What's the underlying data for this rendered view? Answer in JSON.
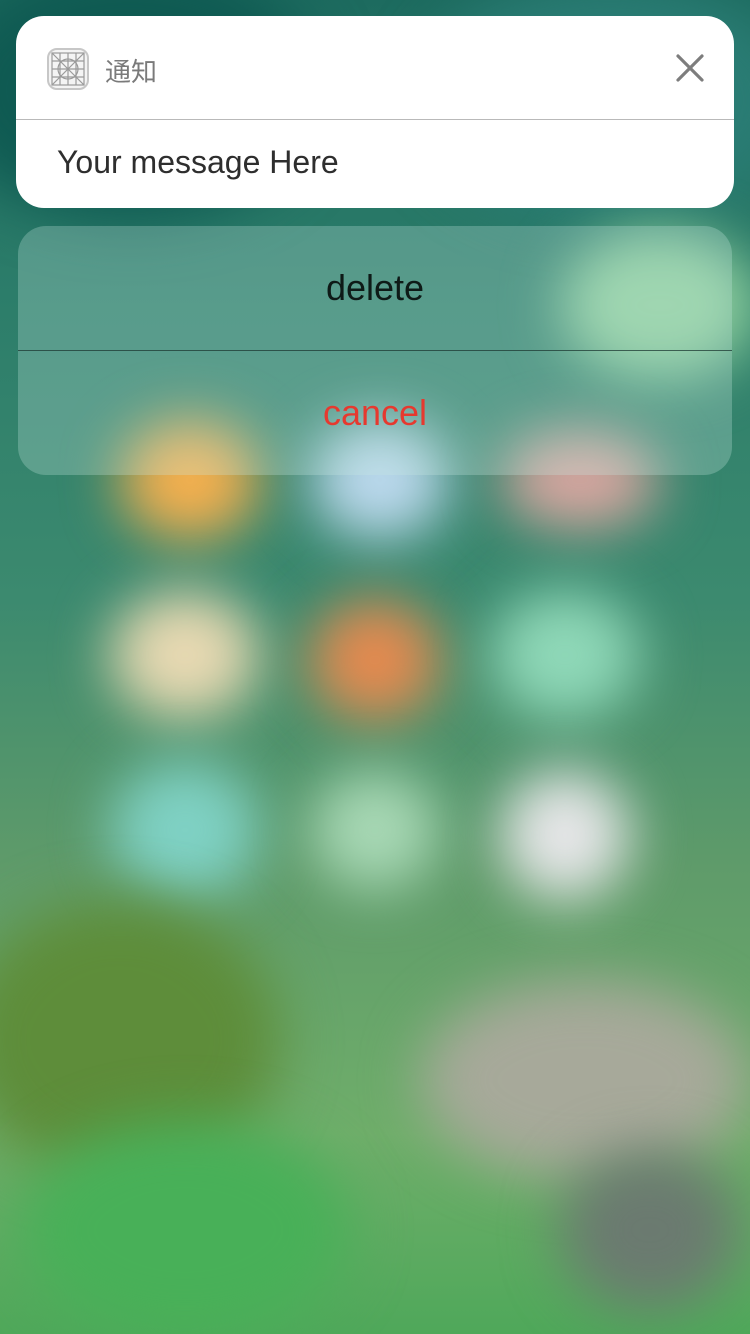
{
  "notification": {
    "app_icon": "grid-app-icon",
    "app_name": "通知",
    "close_icon": "close-icon",
    "message": "Your message Here"
  },
  "actions": {
    "delete_label": "delete",
    "cancel_label": "cancel"
  },
  "colors": {
    "cancel": "#e6392f",
    "card_background": "#ffffff"
  }
}
